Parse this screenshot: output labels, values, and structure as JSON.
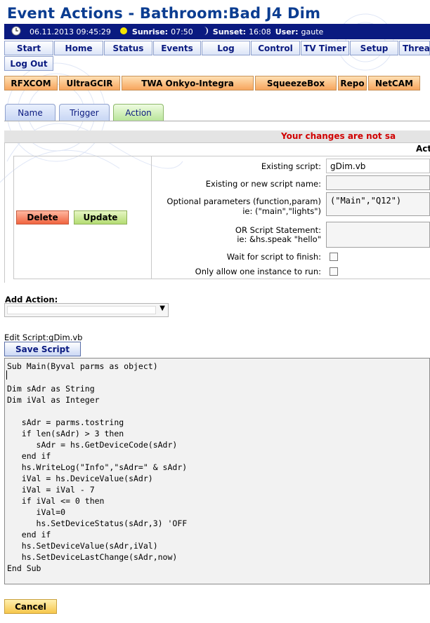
{
  "title": "Event Actions - Bathroom:Bad J4 Dim",
  "status_bar": {
    "datetime": "06.11.2013 09:45:29",
    "sunrise_label": "Sunrise:",
    "sunrise_value": "07:50",
    "sunset_label": "Sunset:",
    "sunset_value": "16:08",
    "user_label": "User:",
    "user_value": "gaute",
    "icons": [
      "clock-icon",
      "sun-icon",
      "moon-icon"
    ]
  },
  "nav": [
    "Start",
    "Home",
    "Status",
    "Events",
    "Log",
    "Control",
    "TV Timer",
    "Setup",
    "Threa"
  ],
  "nav2": [
    "Log Out"
  ],
  "plugins": [
    "RFXCOM",
    "UltraGCIR",
    "TWA Onkyo-Integra",
    "SqueezeBox",
    "Repo",
    "NetCAM"
  ],
  "tabs": [
    "Name",
    "Trigger",
    "Action"
  ],
  "warning": "Your changes are not sa",
  "action_header": "Act",
  "buttons": {
    "delete": "Delete",
    "update": "Update",
    "save_script": "Save Script",
    "cancel": "Cancel"
  },
  "form": {
    "existing_script_label": "Existing script:",
    "existing_script_value": "gDim.vb",
    "new_script_label": "Existing or new script name:",
    "new_script_value": "",
    "params_label_1": "Optional parameters (function,param)",
    "params_label_2": "ie: (\"main\",\"lights\")",
    "params_value": "(\"Main\",\"Q12\")",
    "statement_label_1": "OR Script Statement:",
    "statement_label_2": "ie: &hs.speak \"hello\"",
    "statement_value": "",
    "wait_label": "Wait for script to finish:",
    "wait_checked": false,
    "one_instance_label": "Only allow one instance to run:",
    "one_instance_checked": false
  },
  "add_action": {
    "label": "Add Action:",
    "selected": ""
  },
  "edit_script_label": "Edit Script:gDim.vb",
  "script_code": "Sub Main(Byval parms as object)\n\nDim sAdr as String\nDim iVal as Integer\n\n   sAdr = parms.tostring\n   if len(sAdr) > 3 then\n      sAdr = hs.GetDeviceCode(sAdr)\n   end if\n   hs.WriteLog(\"Info\",\"sAdr=\" & sAdr)\n   iVal = hs.DeviceValue(sAdr)\n   iVal = iVal - 7\n   if iVal <= 0 then\n      iVal=0\n      hs.SetDeviceStatus(sAdr,3) 'OFF\n   end if\n   hs.SetDeviceValue(sAdr,iVal)\n   hs.SetDeviceLastChange(sAdr,now)\nEnd Sub",
  "colors": {
    "title": "#0b3d91",
    "status_bar_bg": "#0a1a80",
    "warning": "#d00000",
    "delete_button": "#f0643f",
    "update_button": "#b4dc73",
    "cancel_button": "#f6c64c",
    "plugin_button": "#f7a55d",
    "action_tab": "#b9e59a"
  }
}
